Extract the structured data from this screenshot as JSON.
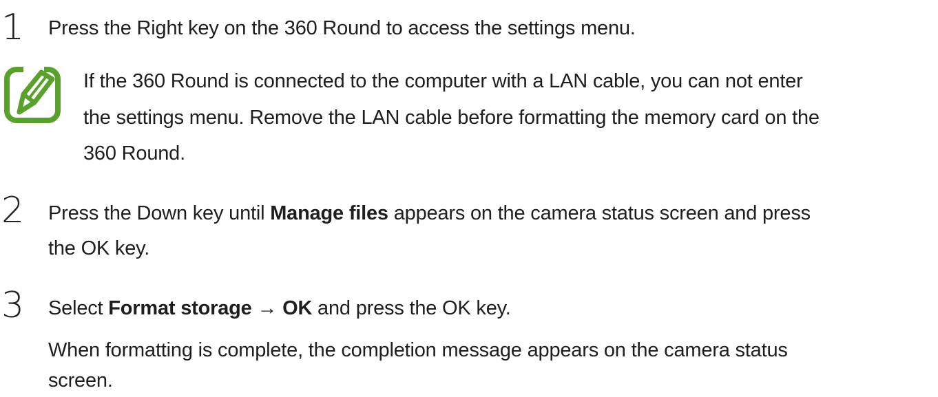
{
  "steps": [
    {
      "number": "1",
      "text": "Press the Right key on the 360 Round to access the settings menu."
    },
    {
      "number": "2",
      "line1_a": "Press the Down key until ",
      "line1_b": "Manage files",
      "line1_c": " appears on the camera status screen and press",
      "line2": "the OK key."
    },
    {
      "number": "3",
      "line1_a": "Select ",
      "line1_b": "Format storage",
      "line1_c": " → ",
      "line1_d": "OK",
      "line1_e": " and press the OK key.",
      "sub_line1": "When formatting is complete, the completion message appears on the camera status",
      "sub_line2": "screen."
    }
  ],
  "note": {
    "icon": "note-pencil-icon",
    "icon_color": "#5aa02c",
    "line1": "If the 360 Round is connected to the computer with a LAN cable, you can not enter",
    "line2": "the settings menu. Remove the LAN cable before formatting the memory card on the",
    "line3": "360 Round."
  }
}
